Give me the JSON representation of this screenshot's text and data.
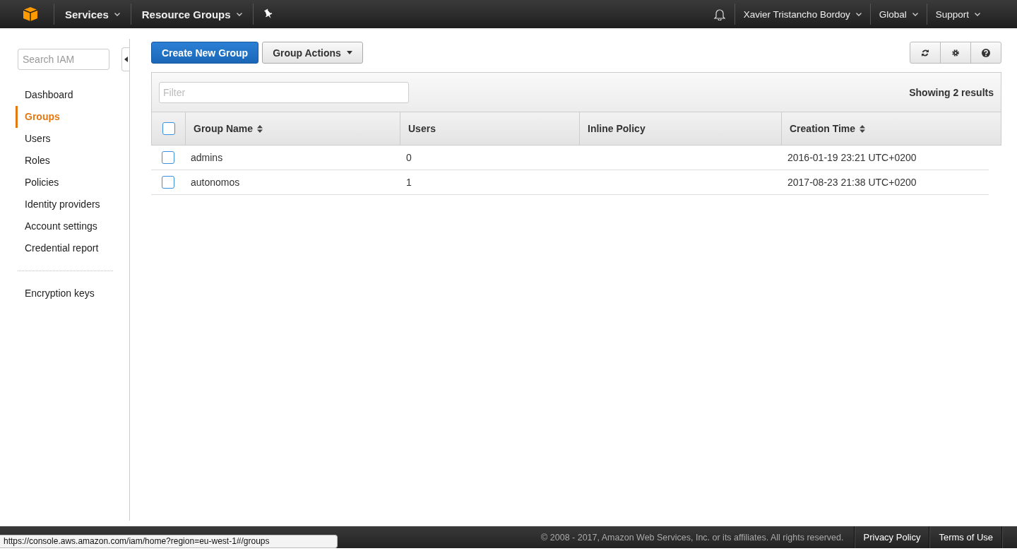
{
  "top_bar": {
    "left_menus": [
      {
        "label": "Services",
        "dropdown": true
      },
      {
        "label": "Resource Groups",
        "dropdown": true
      }
    ],
    "right_menus": [
      {
        "label": "Xavier Tristancho Bordoy",
        "dropdown": true
      },
      {
        "label": "Global",
        "dropdown": true
      },
      {
        "label": "Support",
        "dropdown": true
      }
    ]
  },
  "sidebar": {
    "search": {
      "placeholder": "Search IAM"
    },
    "sections": [
      {
        "items": [
          {
            "label": "Dashboard",
            "selected": false
          },
          {
            "label": "Groups",
            "selected": true
          },
          {
            "label": "Users",
            "selected": false
          },
          {
            "label": "Roles",
            "selected": false
          },
          {
            "label": "Policies",
            "selected": false
          },
          {
            "label": "Identity providers",
            "selected": false
          },
          {
            "label": "Account settings",
            "selected": false
          },
          {
            "label": "Credential report",
            "selected": false
          }
        ]
      },
      {
        "items": [
          {
            "label": "Encryption keys",
            "selected": false
          }
        ]
      }
    ]
  },
  "toolbar": {
    "buttons": [
      {
        "label": "Create New Group",
        "kind": "primary",
        "dropdown": false
      },
      {
        "label": "Group Actions",
        "kind": "secondary",
        "dropdown": true
      }
    ]
  },
  "table": {
    "filter": {
      "placeholder": "Filter"
    },
    "result_count": "Showing 2 results",
    "select_all": {
      "checked": false
    },
    "columns": [
      {
        "label": "Group Name",
        "sortable": true
      },
      {
        "label": "Users",
        "sortable": false
      },
      {
        "label": "Inline Policy",
        "sortable": false
      },
      {
        "label": "Creation Time",
        "sortable": true
      }
    ],
    "rows": [
      {
        "checked": false,
        "cells": [
          "admins",
          "0",
          "",
          "2016-01-19 23:21 UTC+0200"
        ]
      },
      {
        "checked": false,
        "cells": [
          "autonomos",
          "1",
          "",
          "2017-08-23 21:38 UTC+0200"
        ]
      }
    ]
  },
  "footer": {
    "copyright": "© 2008 - 2017, Amazon Web Services, Inc. or its affiliates. All rights reserved.",
    "links": [
      "Privacy Policy",
      "Terms of Use"
    ]
  },
  "status_url": "https://console.aws.amazon.com/iam/home?region=eu-west-1#/groups"
}
